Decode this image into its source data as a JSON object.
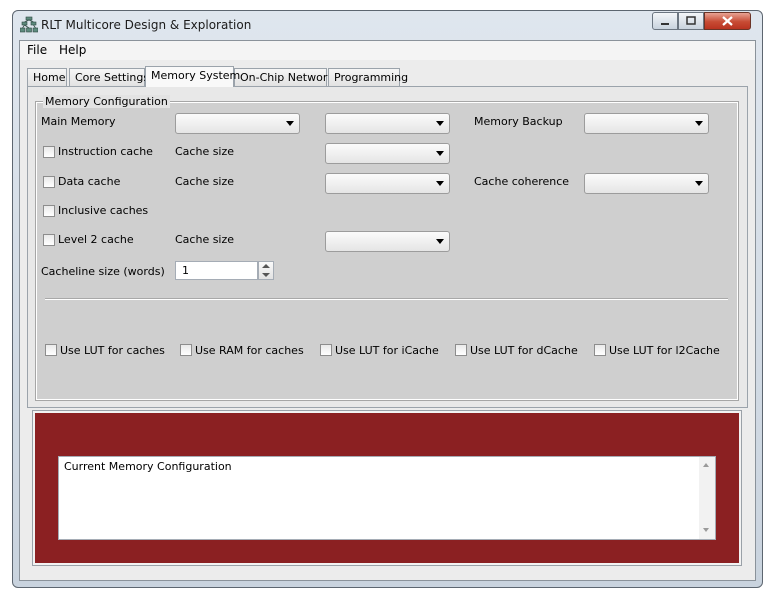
{
  "window": {
    "title": "RLT Multicore Design & Exploration"
  },
  "menu": {
    "file": "File",
    "help": "Help"
  },
  "tabs": [
    {
      "label": "Home"
    },
    {
      "label": "Core Settings"
    },
    {
      "label": "Memory System"
    },
    {
      "label": "On-Chip Network"
    },
    {
      "label": "Programming"
    }
  ],
  "memory_config": {
    "group_title": "Memory Configuration",
    "main_memory_label": "Main Memory",
    "memory_backup_label": "Memory Backup",
    "instruction_cache_label": "Instruction cache",
    "data_cache_label": "Data cache",
    "cache_size_label": "Cache size",
    "cache_coherence_label": "Cache coherence",
    "inclusive_caches_label": "Inclusive caches",
    "level2_cache_label": "Level 2 cache",
    "cacheline_size_label": "Cacheline size (words)",
    "cacheline_size_value": "1"
  },
  "lut_options": [
    {
      "label": "Use LUT for caches"
    },
    {
      "label": "Use RAM for caches"
    },
    {
      "label": "Use LUT for iCache"
    },
    {
      "label": "Use LUT for dCache"
    },
    {
      "label": "Use LUT for l2Cache"
    }
  ],
  "output": {
    "text": "Current Memory Configuration"
  },
  "colors": {
    "panel_red": "#8b2022",
    "close_button": "#c74b34"
  }
}
